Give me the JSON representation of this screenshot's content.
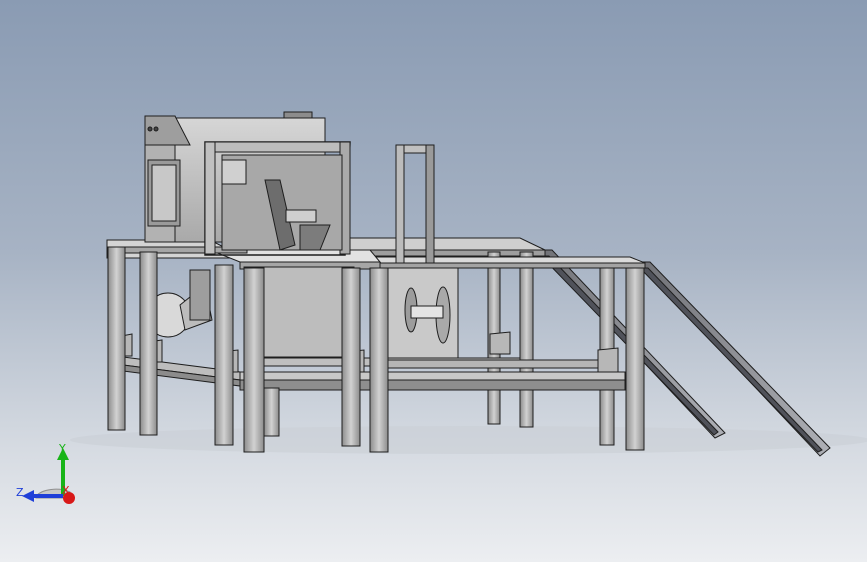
{
  "triad": {
    "y_label": "Y",
    "z_label": "Z",
    "x_label": "X",
    "y_color": "#18b418",
    "z_color": "#1f3fd8",
    "x_color": "#d81818"
  },
  "colors": {
    "background_top": "#8a9bb3",
    "background_bottom": "#eceef1",
    "steel": "#b9b9b9",
    "steel_dark": "#7b7b7b",
    "panel": "#c6c6c6",
    "edge": "#222222"
  }
}
